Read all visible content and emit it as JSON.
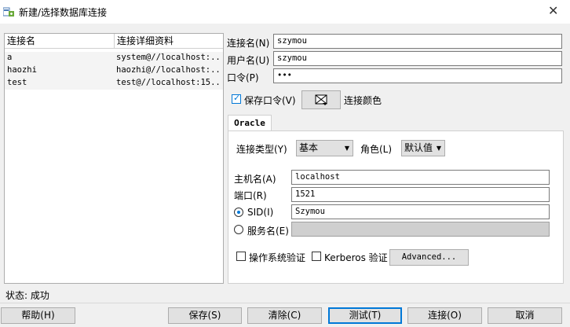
{
  "window": {
    "title": "新建/选择数据库连接"
  },
  "list": {
    "headers": [
      "连接名",
      "连接详细资料"
    ],
    "rows": [
      {
        "name": "a",
        "detail": "system@//localhost:..."
      },
      {
        "name": "haozhi",
        "detail": "haozhi@//localhost:..."
      },
      {
        "name": "test",
        "detail": "test@//localhost:15..."
      }
    ]
  },
  "form": {
    "conn_name_label": "连接名(N)",
    "conn_name_value": "szymou",
    "user_label": "用户名(U)",
    "user_value": "szymou",
    "password_label": "口令(P)",
    "password_value": "•••",
    "save_password_label": "保存口令(V)",
    "conn_color_label": "连接颜色"
  },
  "oracle": {
    "tab_label": "Oracle",
    "conn_type_label": "连接类型(Y)",
    "conn_type_value": "基本",
    "role_label": "角色(L)",
    "role_value": "默认值",
    "host_label": "主机名(A)",
    "host_value": "localhost",
    "port_label": "端口(R)",
    "port_value": "1521",
    "sid_label": "SID(I)",
    "sid_value": "Szymou",
    "service_label": "服务名(E)",
    "service_value": "",
    "os_auth_label": "操作系统验证",
    "kerberos_label": "Kerberos 验证",
    "advanced_label": "Advanced..."
  },
  "status": {
    "text": "状态: 成功"
  },
  "buttons": {
    "help": "帮助(H)",
    "save": "保存(S)",
    "clear": "清除(C)",
    "test": "测试(T)",
    "connect": "连接(O)",
    "cancel": "取消"
  }
}
